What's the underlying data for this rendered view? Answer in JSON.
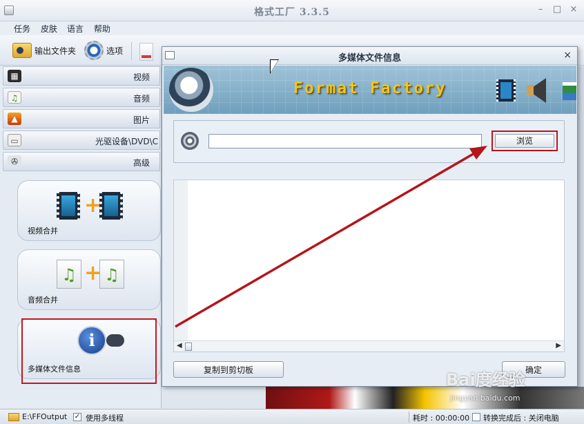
{
  "app": {
    "title": "格式工厂 3.3.5",
    "minimize": "–",
    "maximize": "□",
    "close": "×"
  },
  "menu": [
    "任务",
    "皮肤",
    "语言",
    "帮助"
  ],
  "toolbar": {
    "output_folder": "输出文件夹",
    "options": "选项"
  },
  "sidebar": {
    "categories": [
      {
        "label": "视频",
        "icon": "video-icon",
        "glyph": "▦"
      },
      {
        "label": "音频",
        "icon": "audio-icon",
        "glyph": "♫"
      },
      {
        "label": "图片",
        "icon": "picture-icon",
        "glyph": "▲"
      },
      {
        "label": "光驱设备\\DVD\\C",
        "icon": "drive-icon",
        "glyph": "▭"
      },
      {
        "label": "高级",
        "icon": "reel-icon",
        "glyph": "✇"
      }
    ],
    "tiles": [
      {
        "label": "视频合并",
        "icon": "video-merge-icon"
      },
      {
        "label": "音频合并",
        "icon": "audio-merge-icon"
      },
      {
        "label": "多媒体文件信息",
        "icon": "media-info-icon"
      }
    ]
  },
  "dialog": {
    "title": "多媒体文件信息",
    "close": "×",
    "brand": "Format Factory",
    "file_path": "",
    "browse": "浏览",
    "copy_to_clipboard": "复制到剪切板",
    "ok": "确定"
  },
  "status": {
    "output_path": "E:\\FFOutput",
    "multithread_label": "使用多线程",
    "multithread_checked": "✓",
    "elapsed": "耗时 : 00:00:00",
    "after_done": "转换完成后 : 关闭电脑"
  },
  "watermark": {
    "text": "Bai度经验",
    "sub": "jingyan.baidu.com"
  },
  "colors": {
    "highlight": "#c0181d",
    "brand_text": "#f3c41a"
  }
}
